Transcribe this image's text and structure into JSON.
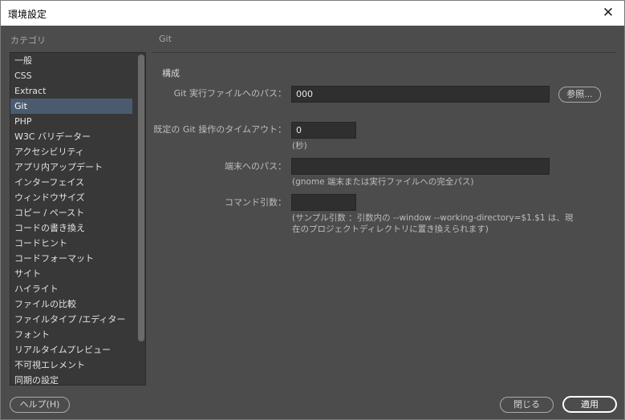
{
  "window": {
    "title": "環境設定",
    "close_glyph": "✕"
  },
  "sidebar": {
    "heading": "カテゴリ",
    "items": [
      {
        "label": "一般"
      },
      {
        "label": "CSS"
      },
      {
        "label": "Extract"
      },
      {
        "label": "Git",
        "selected": true
      },
      {
        "label": "PHP"
      },
      {
        "label": "W3C バリデーター"
      },
      {
        "label": "アクセシビリティ"
      },
      {
        "label": "アプリ内アップデート"
      },
      {
        "label": "インターフェイス"
      },
      {
        "label": "ウィンドウサイズ"
      },
      {
        "label": "コピー / ペースト"
      },
      {
        "label": "コードの書き換え"
      },
      {
        "label": "コードヒント"
      },
      {
        "label": "コードフォーマット"
      },
      {
        "label": "サイト"
      },
      {
        "label": "ハイライト"
      },
      {
        "label": "ファイルの比較"
      },
      {
        "label": "ファイルタイプ /エディター"
      },
      {
        "label": "フォント"
      },
      {
        "label": "リアルタイムプレビュー"
      },
      {
        "label": "不可視エレメント"
      },
      {
        "label": "同期の設定"
      }
    ]
  },
  "panel": {
    "title": "Git",
    "section": "構成",
    "git_path": {
      "label": "Git 実行ファイルへのパス：",
      "value": "000",
      "browse": "参照..."
    },
    "timeout": {
      "label": "既定の Git 操作のタイムアウト：",
      "value": "0",
      "unit": "(秒)"
    },
    "terminal": {
      "label": "端末へのパス：",
      "value": "",
      "hint": "(gnome 端末または実行ファイルへの完全パス)"
    },
    "cmdargs": {
      "label": "コマンド引数：",
      "value": "",
      "hint1": "(サンプル引数 ：引数内の --window --working-directory=$1.$1 は、現",
      "hint2": "在のプロジェクトディレクトリに置き換えられます)"
    }
  },
  "footer": {
    "help": "ヘルプ(H)",
    "close": "閉じる",
    "apply": "適用"
  },
  "colors": {
    "window_bg": "#4c4c4c",
    "list_bg": "#383838",
    "selected": "#4a5b70",
    "field_bg": "#2f2f2f"
  }
}
